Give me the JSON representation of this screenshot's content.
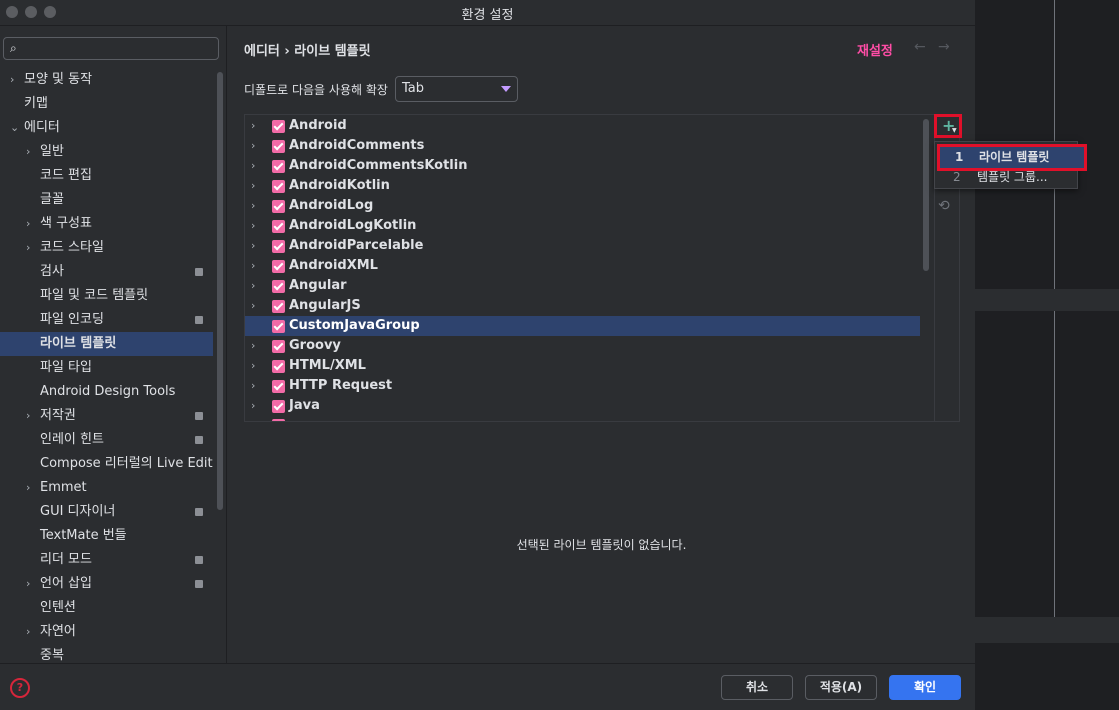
{
  "window": {
    "title": "환경 설정"
  },
  "sidebar": {
    "search_placeholder": "",
    "items": [
      {
        "label": "모양 및 동작",
        "arrow": "›"
      },
      {
        "label": "키맵"
      },
      {
        "label": "에디터",
        "arrow": "⌄"
      },
      {
        "label": "일반",
        "arrow": "›"
      },
      {
        "label": "코드 편집"
      },
      {
        "label": "글꼴"
      },
      {
        "label": "색 구성표",
        "arrow": "›"
      },
      {
        "label": "코드 스타일",
        "arrow": "›"
      },
      {
        "label": "검사"
      },
      {
        "label": "파일 및 코드 템플릿"
      },
      {
        "label": "파일 인코딩"
      },
      {
        "label": "라이브 템플릿"
      },
      {
        "label": "파일 타입"
      },
      {
        "label": "Android Design Tools"
      },
      {
        "label": "저작권",
        "arrow": "›"
      },
      {
        "label": "인레이 힌트"
      },
      {
        "label": "Compose 리터럴의 Live Edit"
      },
      {
        "label": "Emmet",
        "arrow": "›"
      },
      {
        "label": "GUI 디자이너"
      },
      {
        "label": "TextMate 번들"
      },
      {
        "label": "리더 모드"
      },
      {
        "label": "언어 삽입",
        "arrow": "›"
      },
      {
        "label": "인텐션"
      },
      {
        "label": "자연어",
        "arrow": "›"
      },
      {
        "label": "중복"
      }
    ]
  },
  "main": {
    "breadcrumb": "에디터  ›  라이브 템플릿",
    "reset_label": "재설정",
    "back_arrow": "←",
    "forward_arrow": "→",
    "expand_label": "디폴트로 다음을 사용해 확장",
    "expand_value": "Tab",
    "template_groups": [
      "Android",
      "AndroidComments",
      "AndroidCommentsKotlin",
      "AndroidKotlin",
      "AndroidLog",
      "AndroidLogKotlin",
      "AndroidParcelable",
      "AndroidXML",
      "Angular",
      "AngularJS",
      "CustomJavaGroup",
      "Groovy",
      "HTML/XML",
      "HTTP Request",
      "Java"
    ],
    "selected_group": "CustomJavaGroup",
    "empty_message": "선택된 라이브 템플릿이 없습니다.",
    "add_icon": "+",
    "restore_icon": "⟲",
    "popup": {
      "items": [
        {
          "num": "1",
          "label": "라이브 템플릿"
        },
        {
          "num": "2",
          "label": "템플릿 그룹..."
        }
      ]
    }
  },
  "footer": {
    "help_icon": "?",
    "cancel_label": "취소",
    "apply_label": "적용(A)",
    "ok_label": "확인"
  },
  "colors": {
    "accent": "#3574f0",
    "selection": "#2e436e",
    "checkbox": "#f26ba7",
    "reset_link": "#ff4da6",
    "highlight_border": "#e0102a"
  }
}
